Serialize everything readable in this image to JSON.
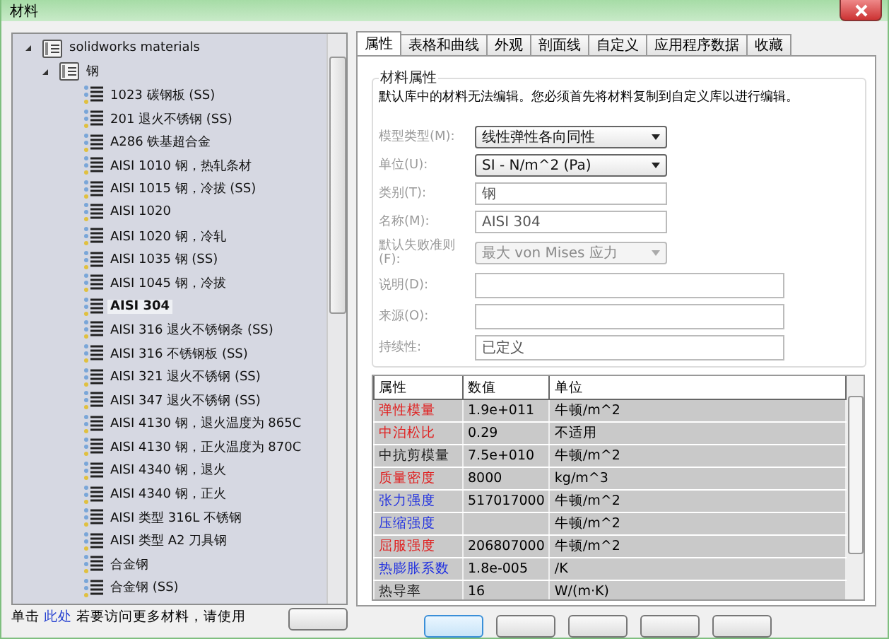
{
  "window": {
    "title": "材料"
  },
  "tree": {
    "label": "solidworks materials",
    "expanded": true,
    "children": [
      {
        "label": "钢",
        "expanded": true,
        "children": [
          {
            "label": "1023 碳钢板 (SS)",
            "selected": false
          },
          {
            "label": "201 退火不锈钢 (SS)",
            "selected": false
          },
          {
            "label": "A286 铁基超合金",
            "selected": false
          },
          {
            "label": "AISI 1010 钢，热轧条材",
            "selected": false
          },
          {
            "label": "AISI 1015 钢，冷拔 (SS)",
            "selected": false
          },
          {
            "label": "AISI 1020",
            "selected": false
          },
          {
            "label": "AISI 1020 钢，冷轧",
            "selected": false
          },
          {
            "label": "AISI 1035 钢 (SS)",
            "selected": false
          },
          {
            "label": "AISI 1045 钢，冷拔",
            "selected": false
          },
          {
            "label": "AISI 304",
            "selected": true
          },
          {
            "label": "AISI 316 退火不锈钢条 (SS)",
            "selected": false
          },
          {
            "label": "AISI 316 不锈钢板 (SS)",
            "selected": false
          },
          {
            "label": "AISI 321 退火不锈钢 (SS)",
            "selected": false
          },
          {
            "label": "AISI 347 退火不锈钢 (SS)",
            "selected": false
          },
          {
            "label": "AISI 4130 钢，退火温度为 865C",
            "selected": false
          },
          {
            "label": "AISI 4130 钢，正火温度为 870C",
            "selected": false
          },
          {
            "label": "AISI 4340 钢，退火",
            "selected": false
          },
          {
            "label": "AISI 4340 钢，正火",
            "selected": false
          },
          {
            "label": "AISI 类型 316L 不锈钢",
            "selected": false
          },
          {
            "label": "AISI 类型 A2 刀具钢",
            "selected": false
          },
          {
            "label": "合金钢",
            "selected": false
          },
          {
            "label": "合金钢 (SS)",
            "selected": false
          }
        ]
      }
    ]
  },
  "hint": {
    "before": "单击",
    "link": "此处",
    "after": "若要访问更多材料，请使用"
  },
  "tabs": [
    {
      "label": "属性",
      "selected": true
    },
    {
      "label": "表格和曲线",
      "selected": false
    },
    {
      "label": "外观",
      "selected": false
    },
    {
      "label": "剖面线",
      "selected": false
    },
    {
      "label": "自定义",
      "selected": false
    },
    {
      "label": "应用程序数据",
      "selected": false
    },
    {
      "label": "收藏",
      "selected": false
    }
  ],
  "properties": {
    "title": "材料属性",
    "notice": "默认库中的材料无法编辑。您必须首先将材料复制到自定义库以进行编辑。",
    "fields": [
      {
        "label": "模型类型(M):",
        "kind": "combo",
        "value": "线性弹性各向同性",
        "disabled": false
      },
      {
        "label": "单位(U):",
        "kind": "combo",
        "value": "SI - N/m^2 (Pa)",
        "disabled": false
      },
      {
        "label": "类别(T):",
        "kind": "text",
        "value": "钢"
      },
      {
        "label": "名称(M):",
        "kind": "text",
        "value": "AISI 304"
      },
      {
        "label": "默认失败准则(F):",
        "kind": "combo",
        "value": "最大 von Mises 应力",
        "disabled": true
      },
      {
        "label": "说明(D):",
        "kind": "text"
      },
      {
        "label": "来源(O):",
        "kind": "text"
      },
      {
        "label": "持续性:",
        "kind": "text",
        "value": "已定义"
      }
    ]
  },
  "table": {
    "columns": [
      "属性",
      "数值",
      "单位"
    ],
    "rows": [
      {
        "name": "弹性模量",
        "value": "1.9e+011",
        "unit": "牛顿/m^2",
        "color": "#e02020"
      },
      {
        "name": "中泊松比",
        "value": "0.29",
        "unit": "不适用",
        "color": "#e02020"
      },
      {
        "name": "中抗剪模量",
        "value": "7.5e+010",
        "unit": "牛顿/m^2",
        "color": "#222222"
      },
      {
        "name": "质量密度",
        "value": "8000",
        "unit": "kg/m^3",
        "color": "#e02020"
      },
      {
        "name": "张力强度",
        "value": "517017000",
        "unit": "牛顿/m^2",
        "color": "#2030e0"
      },
      {
        "name": "压缩强度",
        "unit": "牛顿/m^2",
        "color": "#2030e0"
      },
      {
        "name": "屈服强度",
        "value": "206807000",
        "unit": "牛顿/m^2",
        "color": "#e02020"
      },
      {
        "name": "热膨胀系数",
        "value": "1.8e-005",
        "unit": "/K",
        "color": "#2030e0"
      },
      {
        "name": "热导率",
        "value": "16",
        "unit": "W/(m·K)",
        "color": "#222222"
      }
    ]
  }
}
